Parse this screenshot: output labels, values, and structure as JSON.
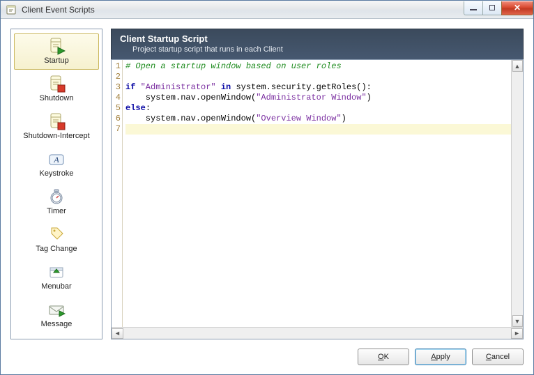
{
  "window": {
    "title": "Client Event Scripts"
  },
  "sidebar": {
    "items": [
      {
        "label": "Startup",
        "icon": "script-run-icon",
        "selected": true
      },
      {
        "label": "Shutdown",
        "icon": "script-stop-icon",
        "selected": false
      },
      {
        "label": "Shutdown-Intercept",
        "icon": "script-stop-icon",
        "selected": false
      },
      {
        "label": "Keystroke",
        "icon": "keystroke-icon",
        "selected": false
      },
      {
        "label": "Timer",
        "icon": "timer-icon",
        "selected": false
      },
      {
        "label": "Tag Change",
        "icon": "tag-icon",
        "selected": false
      },
      {
        "label": "Menubar",
        "icon": "menubar-icon",
        "selected": false
      },
      {
        "label": "Message",
        "icon": "message-icon",
        "selected": false
      }
    ]
  },
  "header": {
    "title": "Client Startup Script",
    "subtitle": "Project startup script that runs in each Client"
  },
  "editor": {
    "active_line": 7,
    "lines": [
      {
        "n": 1,
        "tokens": [
          {
            "t": "# Open a startup window based on user roles",
            "c": "c-comment"
          }
        ]
      },
      {
        "n": 2,
        "tokens": []
      },
      {
        "n": 3,
        "tokens": [
          {
            "t": "if ",
            "c": "c-kw"
          },
          {
            "t": "\"Administrator\"",
            "c": "c-str"
          },
          {
            "t": " "
          },
          {
            "t": "in ",
            "c": "c-kw"
          },
          {
            "t": "system.security.getRoles():"
          }
        ]
      },
      {
        "n": 4,
        "tokens": [
          {
            "t": "    system.nav.openWindow("
          },
          {
            "t": "\"Administrator Window\"",
            "c": "c-str"
          },
          {
            "t": ")"
          }
        ]
      },
      {
        "n": 5,
        "tokens": [
          {
            "t": "else",
            "c": "c-kw"
          },
          {
            "t": ":"
          }
        ]
      },
      {
        "n": 6,
        "tokens": [
          {
            "t": "    system.nav.openWindow("
          },
          {
            "t": "\"Overview Window\"",
            "c": "c-str"
          },
          {
            "t": ")"
          }
        ]
      },
      {
        "n": 7,
        "tokens": []
      }
    ]
  },
  "buttons": {
    "ok": "OK",
    "apply": "Apply",
    "cancel": "Cancel"
  }
}
